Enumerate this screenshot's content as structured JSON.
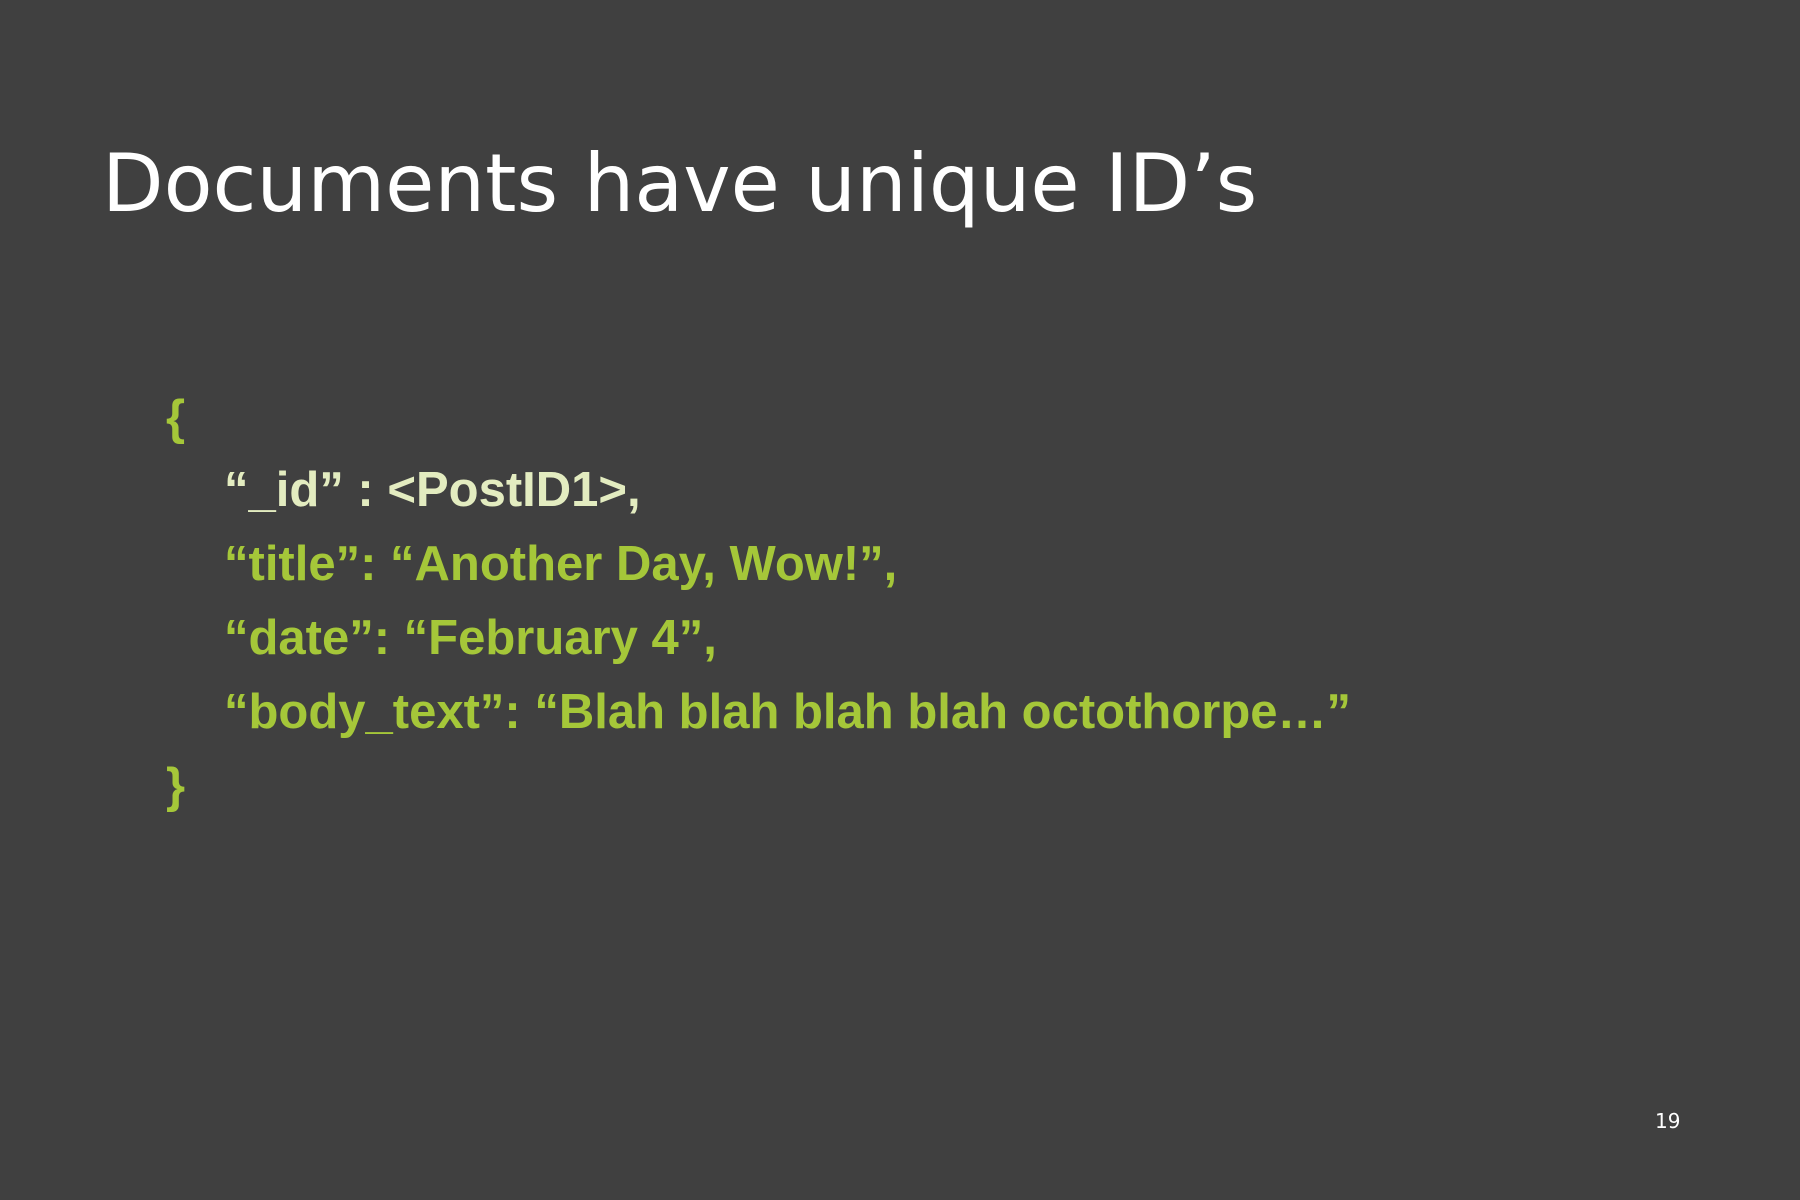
{
  "slide": {
    "title": "Documents have unique ID’s",
    "page_number": "19",
    "colors": {
      "background": "#404040",
      "title": "#ffffff",
      "code_green": "#a5c739",
      "id_highlight": "#e3ecc0"
    }
  },
  "code": {
    "open_brace": "{",
    "id_line": "“_id” : <PostID1>,",
    "title_line": "“title”: “Another Day, Wow!”,",
    "date_line": "“date”: “February 4”,",
    "body_line": "“body_text”: “Blah blah blah blah octothorpe…”",
    "close_brace": "}"
  }
}
